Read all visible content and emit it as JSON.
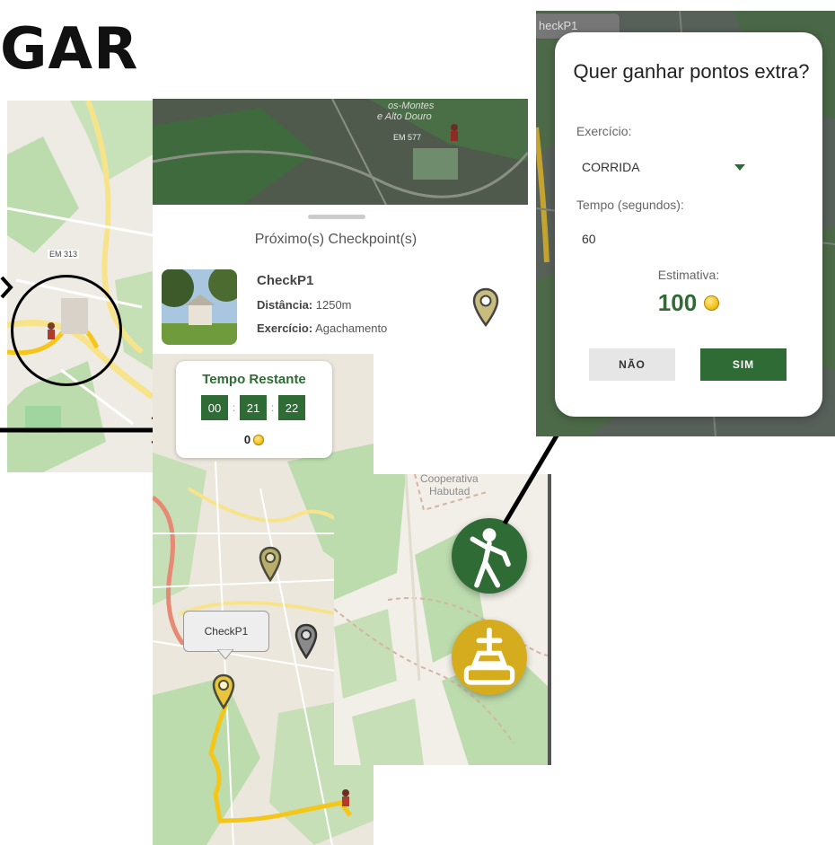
{
  "heading": "GAR",
  "panel": {
    "title": "Próximo(s) Checkpoint(s)",
    "checkpoint": {
      "name": "CheckP1",
      "distance_label": "Distância:",
      "distance_value": "1250m",
      "exercise_label": "Exercício:",
      "exercise_value": "Agachamento"
    }
  },
  "timer": {
    "title": "Tempo Restante",
    "hours": "00",
    "minutes": "21",
    "seconds": "22",
    "separator": ":",
    "coins": "0"
  },
  "map_labels": {
    "checkpoint_bubble": "CheckP1",
    "road_em313": "EM 313",
    "road_em577": "EM 577",
    "place_tras_os_montes": "os-Montes",
    "place_alto_douro": "e Alto Douro",
    "place_cooperativa": "Cooperativa",
    "place_habutad": "Habutad",
    "small_tab": "heckP1"
  },
  "dialog": {
    "title": "Quer ganhar pontos extra?",
    "exercise_label": "Exercício:",
    "exercise_value": "CORRIDA",
    "time_label": "Tempo (segundos):",
    "time_value": "60",
    "estimate_label": "Estimativa:",
    "estimate_value": "100",
    "no_button": "NÃO",
    "yes_button": "SIM"
  },
  "colors": {
    "primary_green": "#2f6b35",
    "gold": "#d4ac1e",
    "route_yellow": "#f5c518",
    "map_green": "#bcdcae",
    "map_background": "#eeebe4"
  },
  "icons": {
    "exercise_fab": "person-exercise-icon",
    "treasure_fab": "treasure-icon",
    "checkpoint_marker": "map-pin-icon",
    "coin": "coin-icon",
    "dropdown": "dropdown-triangle-icon"
  }
}
